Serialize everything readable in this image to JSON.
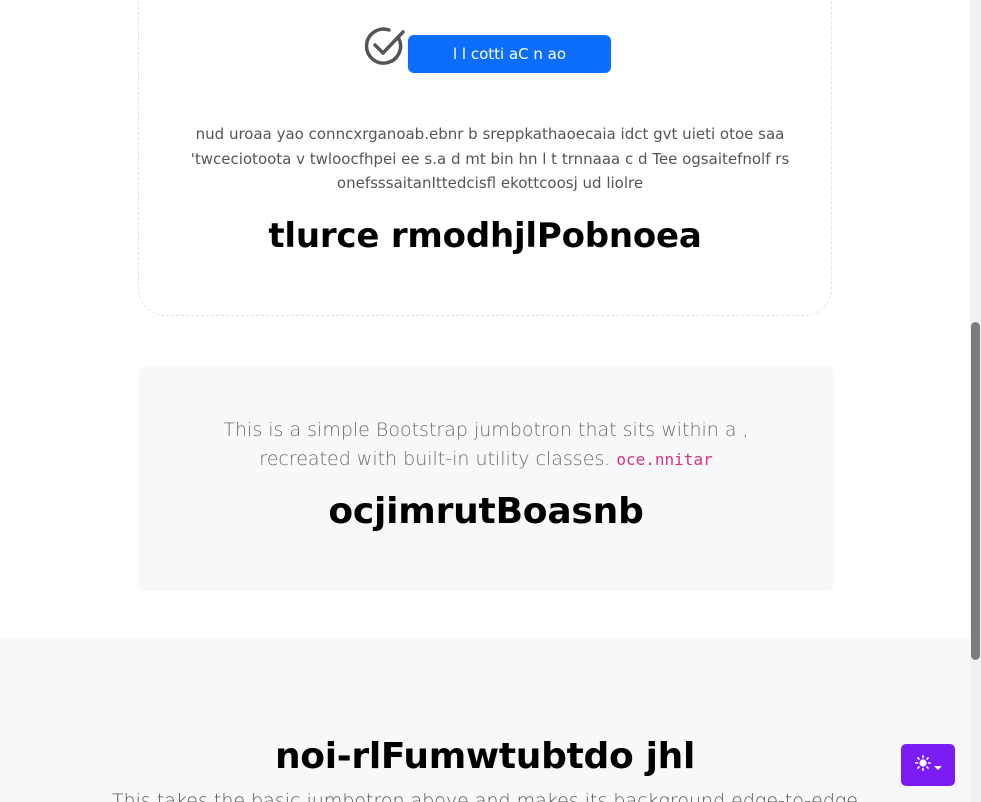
{
  "top_card": {
    "button_label": "l l cotti aC n ao",
    "text": "nud uroaa yao conncxrganoab.ebnr b sreppkathaoecaia idct gvt uieti otoe saa 'twceciotoota v twloocfhpei ee s.a d mt bin hn l t trnnaaa c d Tee ogsaitefnolf rs onefsssaitanIttedcisfl ekottcoosj ud liolre",
    "heading": "tlurce rmodhjlPobnoea"
  },
  "jumbotron": {
    "text": "This is a simple Bootstrap jumbotron that sits within a , recreated with built-in utility classes.",
    "code": "oce.nnitar",
    "heading": "ocjimrutBoasnb"
  },
  "full_section": {
    "heading": "noi-rlFumwtubtdo jhl",
    "subtext": "This takes the basic jumbotron above and makes its background edge-to-edge"
  },
  "icons": {
    "check": "check-circle-icon",
    "theme": "sun-icon",
    "caret": "caret-down-icon"
  },
  "colors": {
    "primary": "#0d6efd",
    "theme_button": "#7c1cf5",
    "code": "#d63384"
  }
}
